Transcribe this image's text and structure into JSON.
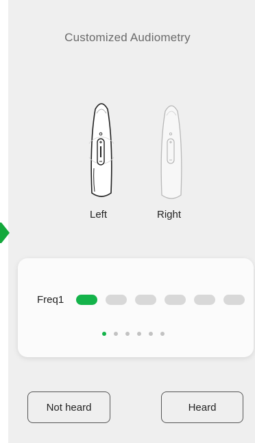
{
  "header": {
    "title": "Customized Audiometry"
  },
  "devices": {
    "left": {
      "label": "Left",
      "selected": true
    },
    "right": {
      "label": "Right",
      "selected": false
    }
  },
  "frequency_card": {
    "label": "Freq1",
    "levels_total": 6,
    "levels_active": 1,
    "pages_total": 6,
    "page_current": 1
  },
  "buttons": {
    "not_heard": "Not heard",
    "heard": "Heard"
  },
  "colors": {
    "accent": "#14b34a",
    "inactive": "#d8d8d8",
    "background": "#efefef"
  }
}
